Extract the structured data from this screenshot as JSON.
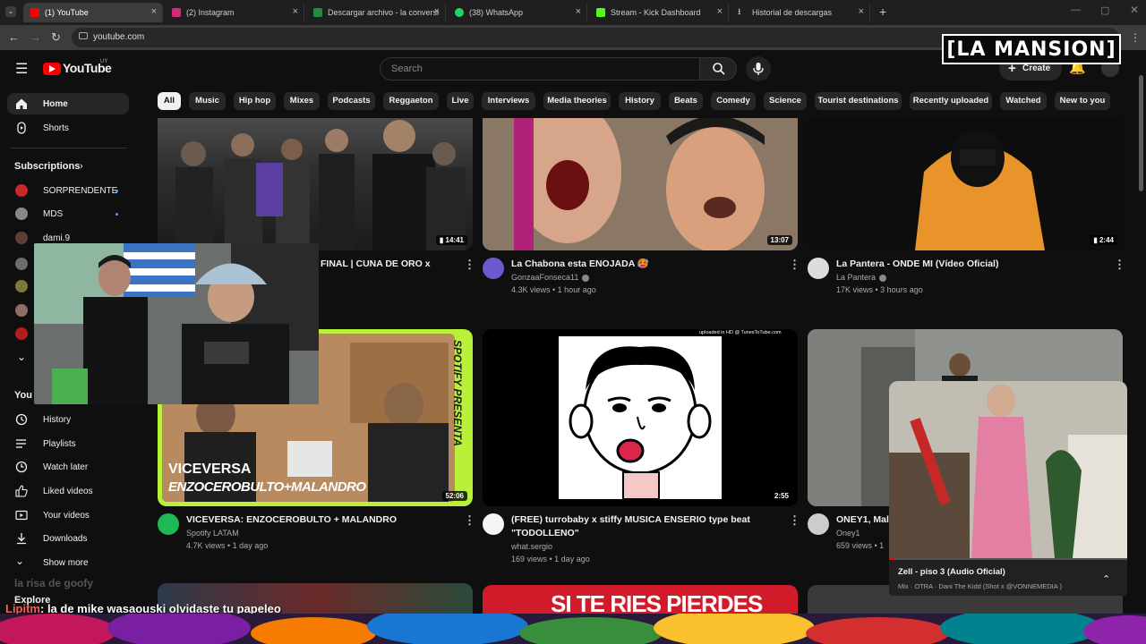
{
  "browser": {
    "tabs": [
      {
        "label": "(1) YouTube",
        "color": "#ff0000"
      },
      {
        "label": "(2) Instagram",
        "color": "#d62976"
      },
      {
        "label": "Descargar archivo - la conversi",
        "color": "#1e8e3e"
      },
      {
        "label": "(38) WhatsApp",
        "color": "#25d366"
      },
      {
        "label": "Stream - Kick Dashboard",
        "color": "#53fc18"
      },
      {
        "label": "Historial de descargas",
        "color": "#cccccc"
      }
    ],
    "new_tab": "+",
    "url": "youtube.com"
  },
  "header": {
    "logo_text": "YouTube",
    "logo_region": "UY",
    "search_placeholder": "Search",
    "create_label": "Create",
    "notif_count": "1",
    "brand_overlay": "[LA MANSION]"
  },
  "sidebar": {
    "items": [
      {
        "label": "Home"
      },
      {
        "label": "Shorts"
      }
    ],
    "subscriptions_title": "Subscriptions",
    "subscriptions": [
      {
        "name": "SORPRENDENTE",
        "color": "#c62828"
      },
      {
        "name": "MDS",
        "color": "#888888"
      },
      {
        "name": "dami.9",
        "color": "#5d4037"
      }
    ],
    "you_title": "You",
    "you_items": [
      {
        "label": "History"
      },
      {
        "label": "Playlists"
      },
      {
        "label": "Watch later"
      },
      {
        "label": "Liked videos"
      },
      {
        "label": "Your videos"
      },
      {
        "label": "Downloads"
      },
      {
        "label": "Show more"
      }
    ],
    "explore_title": "Explore"
  },
  "chips": [
    "All",
    "Music",
    "Hip hop",
    "Mixes",
    "Podcasts",
    "Reggaeton",
    "Live",
    "Interviews",
    "Media theories",
    "History",
    "Beats",
    "Comedy",
    "Science",
    "Tourist destinations",
    "Recently uploaded",
    "Watched",
    "New to you"
  ],
  "videos": [
    {
      "title": "FINAL | CUNA DE ORO x",
      "channel": "",
      "meta": "",
      "duration": "14:41",
      "short_icon": true
    },
    {
      "title": "La Chabona esta ENOJADA 🥵",
      "channel": "GonzaaFonseca11",
      "meta": "4.3K views • 1 hour ago",
      "duration": "13:07"
    },
    {
      "title": "La Pantera - ONDE MI (Vídeo Oficial)",
      "channel": "La Pantera",
      "meta": "17K views • 3 hours ago",
      "duration": "2:44"
    },
    {
      "title": "VICEVERSA: ENZOCEROBULTO + MALANDRO",
      "channel": "Spotify LATAM",
      "meta": "4.7K views • 1 day ago",
      "duration": "52:06",
      "thumb_text1": "VICEVERSA",
      "thumb_text2": "ENZOCEROBULTO+MALANDRO",
      "thumb_side": "SPOTIFY PRESENTA"
    },
    {
      "title": "(FREE) turrobaby x stiffy MUSICA ENSERIO type beat",
      "title2": "\"TODOLLENO\"",
      "channel": "what.sergio",
      "meta": "169 views • 1 day ago",
      "duration": "2:55",
      "thumb_note": "uploaded in HD @ TunesToTube.com"
    },
    {
      "title": "ONEY1, Mala",
      "channel": "Oney1",
      "meta": "659 views • 1",
      "duration": ""
    }
  ],
  "bottom_row": {
    "thumb2_text": "SI TE RIES PIERDES"
  },
  "miniplayer": {
    "title": "Zell - piso 3 (Audio Oficial)",
    "subtitle": "Mix · OTRA · Dani The Kidd (Shot x @VONNEMEDIA )"
  },
  "stream_chat": {
    "faded_line": "la risa de goofy",
    "user": "Lipitm",
    "message": ": la de mike wasaouski olvidaste tu papeleo"
  },
  "colors": {
    "bg": "#0f0f0f",
    "chip": "#272727",
    "accent": "#ff0000",
    "spotify": "#1db954"
  }
}
